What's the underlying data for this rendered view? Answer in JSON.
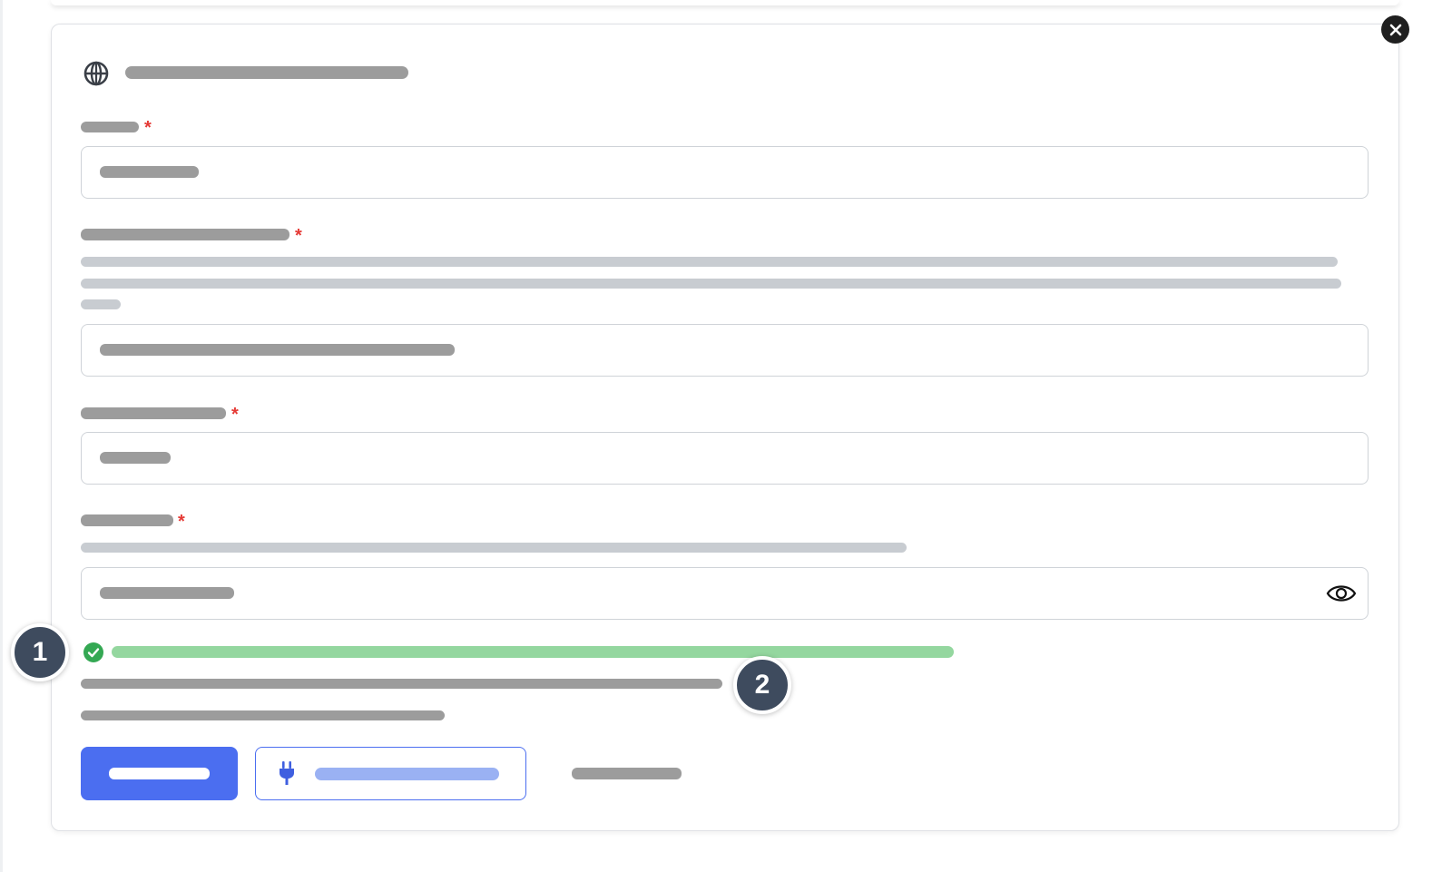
{
  "dialog": {
    "title": "",
    "close_icon": "close-icon",
    "header_icon": "globe-icon"
  },
  "fields": [
    {
      "label": "",
      "required_marker": "*",
      "value": ""
    },
    {
      "label": "",
      "required_marker": "*",
      "description": "",
      "value": ""
    },
    {
      "label": "",
      "required_marker": "*",
      "value": ""
    },
    {
      "label": "",
      "required_marker": "*",
      "description": "",
      "value": "",
      "toggle_icon": "eye-icon"
    }
  ],
  "status": {
    "icon": "check-circle-icon",
    "message": "",
    "detail_lines": [
      "",
      ""
    ]
  },
  "callouts": [
    "1",
    "2"
  ],
  "actions": {
    "primary_label": "",
    "test_label": "",
    "test_icon": "plug-icon",
    "tertiary_label": ""
  },
  "colors": {
    "primary": "#4b6ef0",
    "success": "#34a853",
    "required": "#e53935",
    "callout": "#3e4b5e"
  }
}
